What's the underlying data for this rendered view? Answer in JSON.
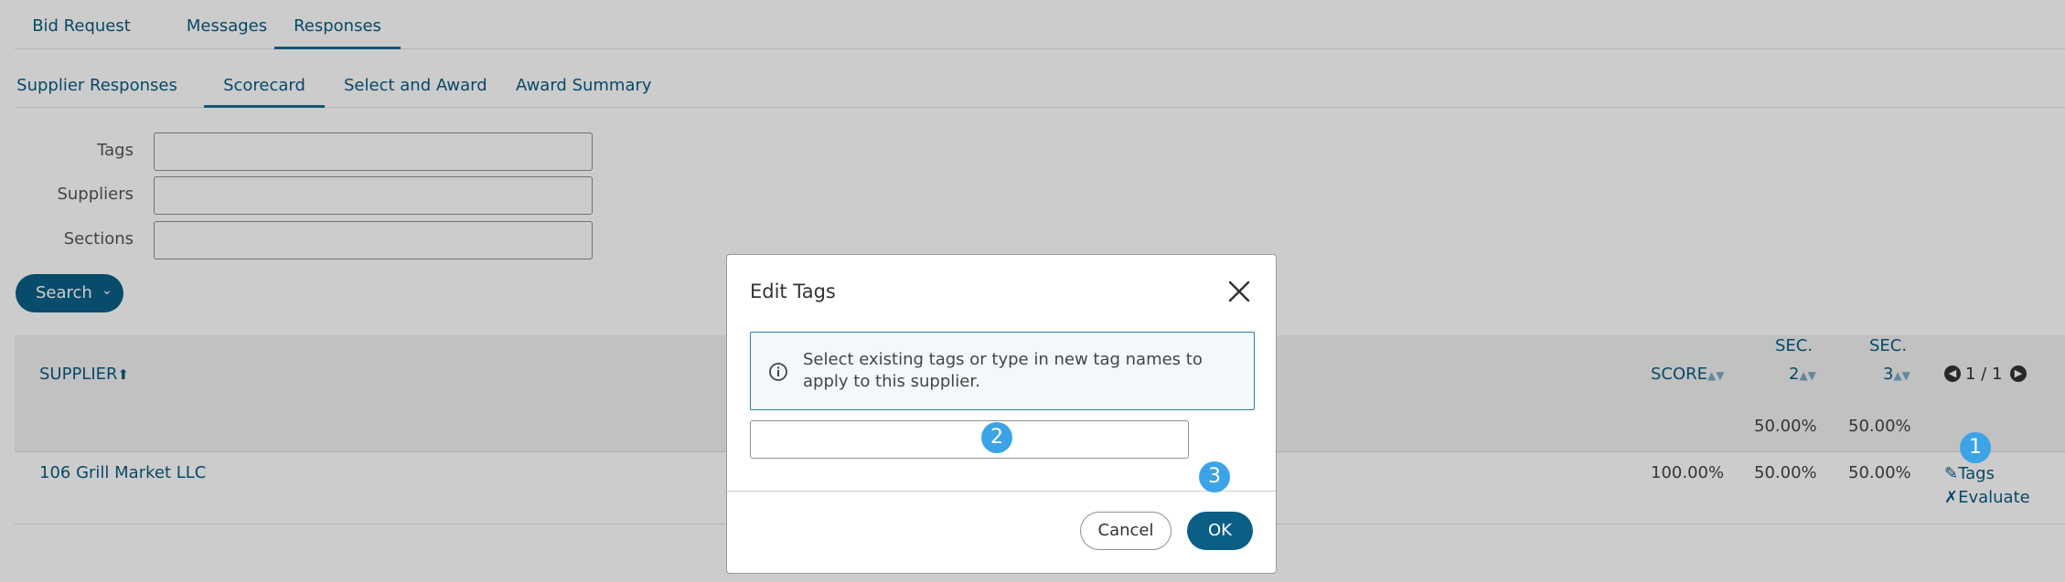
{
  "tabs_primary": [
    {
      "label": "Bid Request"
    },
    {
      "label": "Messages"
    },
    {
      "label": "Responses",
      "active": true
    }
  ],
  "tabs_secondary": [
    {
      "label": "Supplier Responses"
    },
    {
      "label": "Scorecard",
      "active": true
    },
    {
      "label": "Select and Award"
    },
    {
      "label": "Award Summary"
    }
  ],
  "filters": {
    "tags_label": "Tags",
    "suppliers_label": "Suppliers",
    "sections_label": "Sections",
    "tags_value": "",
    "suppliers_value": "",
    "sections_value": ""
  },
  "search_button": {
    "label": "Search"
  },
  "table": {
    "col_supplier": "SUPPLIER",
    "col_score": "SCORE",
    "col_sec2_top": "SEC.",
    "col_sec2_num": "2",
    "col_sec3_top": "SEC.",
    "col_sec3_num": "3",
    "pagination": "1 / 1",
    "sec2_weight": "50.00%",
    "sec3_weight": "50.00%",
    "row": {
      "supplier": "106 Grill Market LLC",
      "score": "100.00%",
      "sec2": "50.00%",
      "sec3": "50.00%",
      "tags_action": "Tags",
      "evaluate_action": "Evaluate"
    }
  },
  "badges": [
    "1",
    "2",
    "3"
  ],
  "modal": {
    "title": "Edit Tags",
    "info": "Select existing tags or type in new tag names to apply to this supplier.",
    "tags_value": "",
    "cancel_label": "Cancel",
    "ok_label": "OK"
  },
  "colors": {
    "primary": "#0b5f86",
    "link": "#0b5a80",
    "badge": "#3ba3e6",
    "info_border": "#2d7fa8"
  }
}
